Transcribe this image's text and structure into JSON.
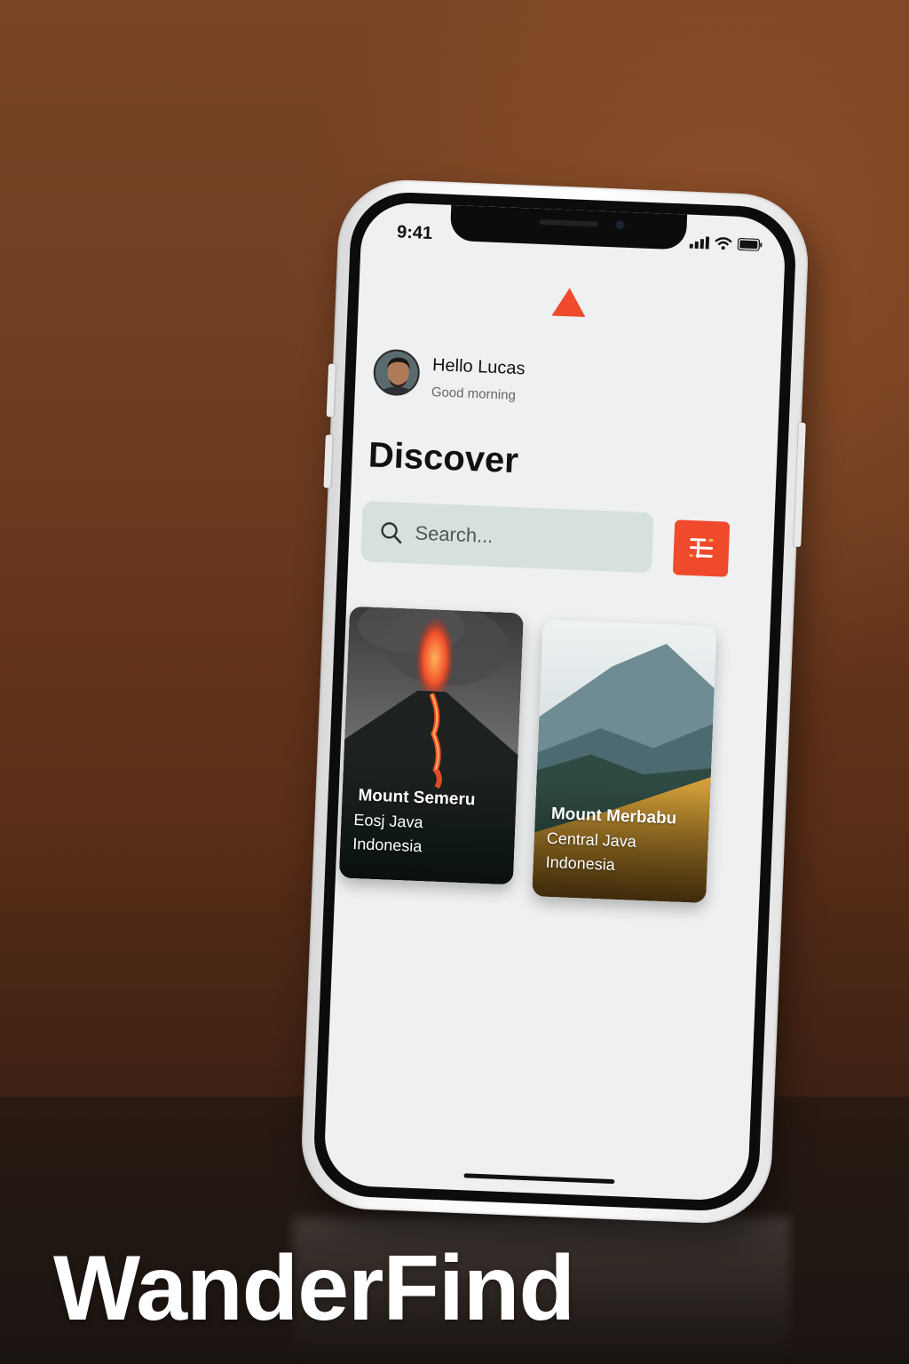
{
  "status_bar": {
    "time": "9:41",
    "icons": [
      "signal-icon",
      "wifi-icon",
      "battery-icon"
    ]
  },
  "app": {
    "logo_icon": "triangle-logo-icon",
    "accent_color": "#ee4a2b"
  },
  "user": {
    "greeting": "Hello Lucas",
    "subtitle": "Good morning"
  },
  "page": {
    "title": "Discover"
  },
  "search": {
    "placeholder": "Search...",
    "value": "",
    "icon": "search-icon"
  },
  "filter": {
    "icon": "filter-icon"
  },
  "destinations": [
    {
      "name": "Mount Semeru",
      "region": "Eosj Java",
      "country": "Indonesia"
    },
    {
      "name": "Mount Merbabu",
      "region": "Central Java",
      "country": "Indonesia"
    }
  ],
  "brand": {
    "name": "WanderFind"
  }
}
